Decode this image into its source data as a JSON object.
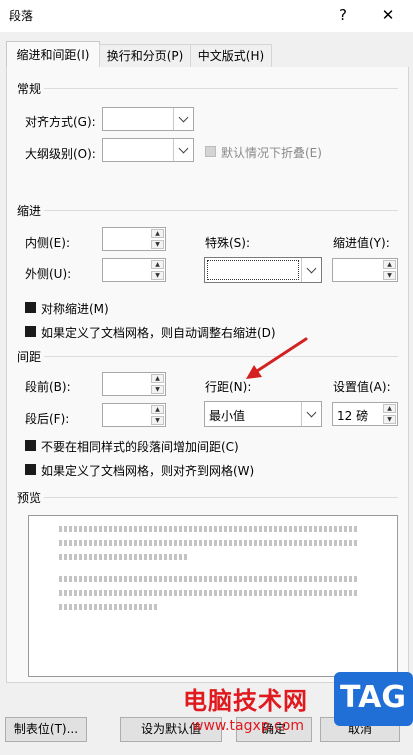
{
  "window": {
    "title": "段落",
    "help": "?",
    "close": "✕"
  },
  "tabs": [
    {
      "label": "缩进和间距(I)"
    },
    {
      "label": "换行和分页(P)"
    },
    {
      "label": "中文版式(H)"
    }
  ],
  "general": {
    "heading": "常规",
    "alignment_label": "对齐方式(G):",
    "alignment_value": "",
    "outline_label": "大纲级别(O):",
    "outline_value": "",
    "collapsed_label": "默认情况下折叠(E)"
  },
  "indent": {
    "heading": "缩进",
    "inner_label": "内侧(E):",
    "inner_value": "",
    "outer_label": "外侧(U):",
    "outer_value": "",
    "special_label": "特殊(S):",
    "special_value": "",
    "by_label": "缩进值(Y):",
    "by_value": "",
    "mirror_label": "对称缩进(M)",
    "auto_right_label": "如果定义了文档网格，则自动调整右缩进(D)"
  },
  "spacing": {
    "heading": "间距",
    "before_label": "段前(B):",
    "before_value": "",
    "after_label": "段后(F):",
    "after_value": "",
    "line_label": "行距(N):",
    "line_value": "最小值",
    "at_label": "设置值(A):",
    "at_value": "12 磅",
    "no_space_label": "不要在相同样式的段落间增加间距(C)",
    "snap_grid_label": "如果定义了文档网格，则对齐到网格(W)"
  },
  "preview": {
    "heading": "预览"
  },
  "buttons": {
    "tabs": "制表位(T)...",
    "set_default": "设为默认值",
    "ok": "确定",
    "cancel": "取消"
  },
  "watermark": {
    "site_name": "电脑技术网",
    "url": "www.tagxp.com",
    "logo": "TAG"
  },
  "colors": {
    "annotation_arrow": "#d42020",
    "watermark_red": "#e0191f",
    "logo_blue": "#1f6fd6"
  }
}
